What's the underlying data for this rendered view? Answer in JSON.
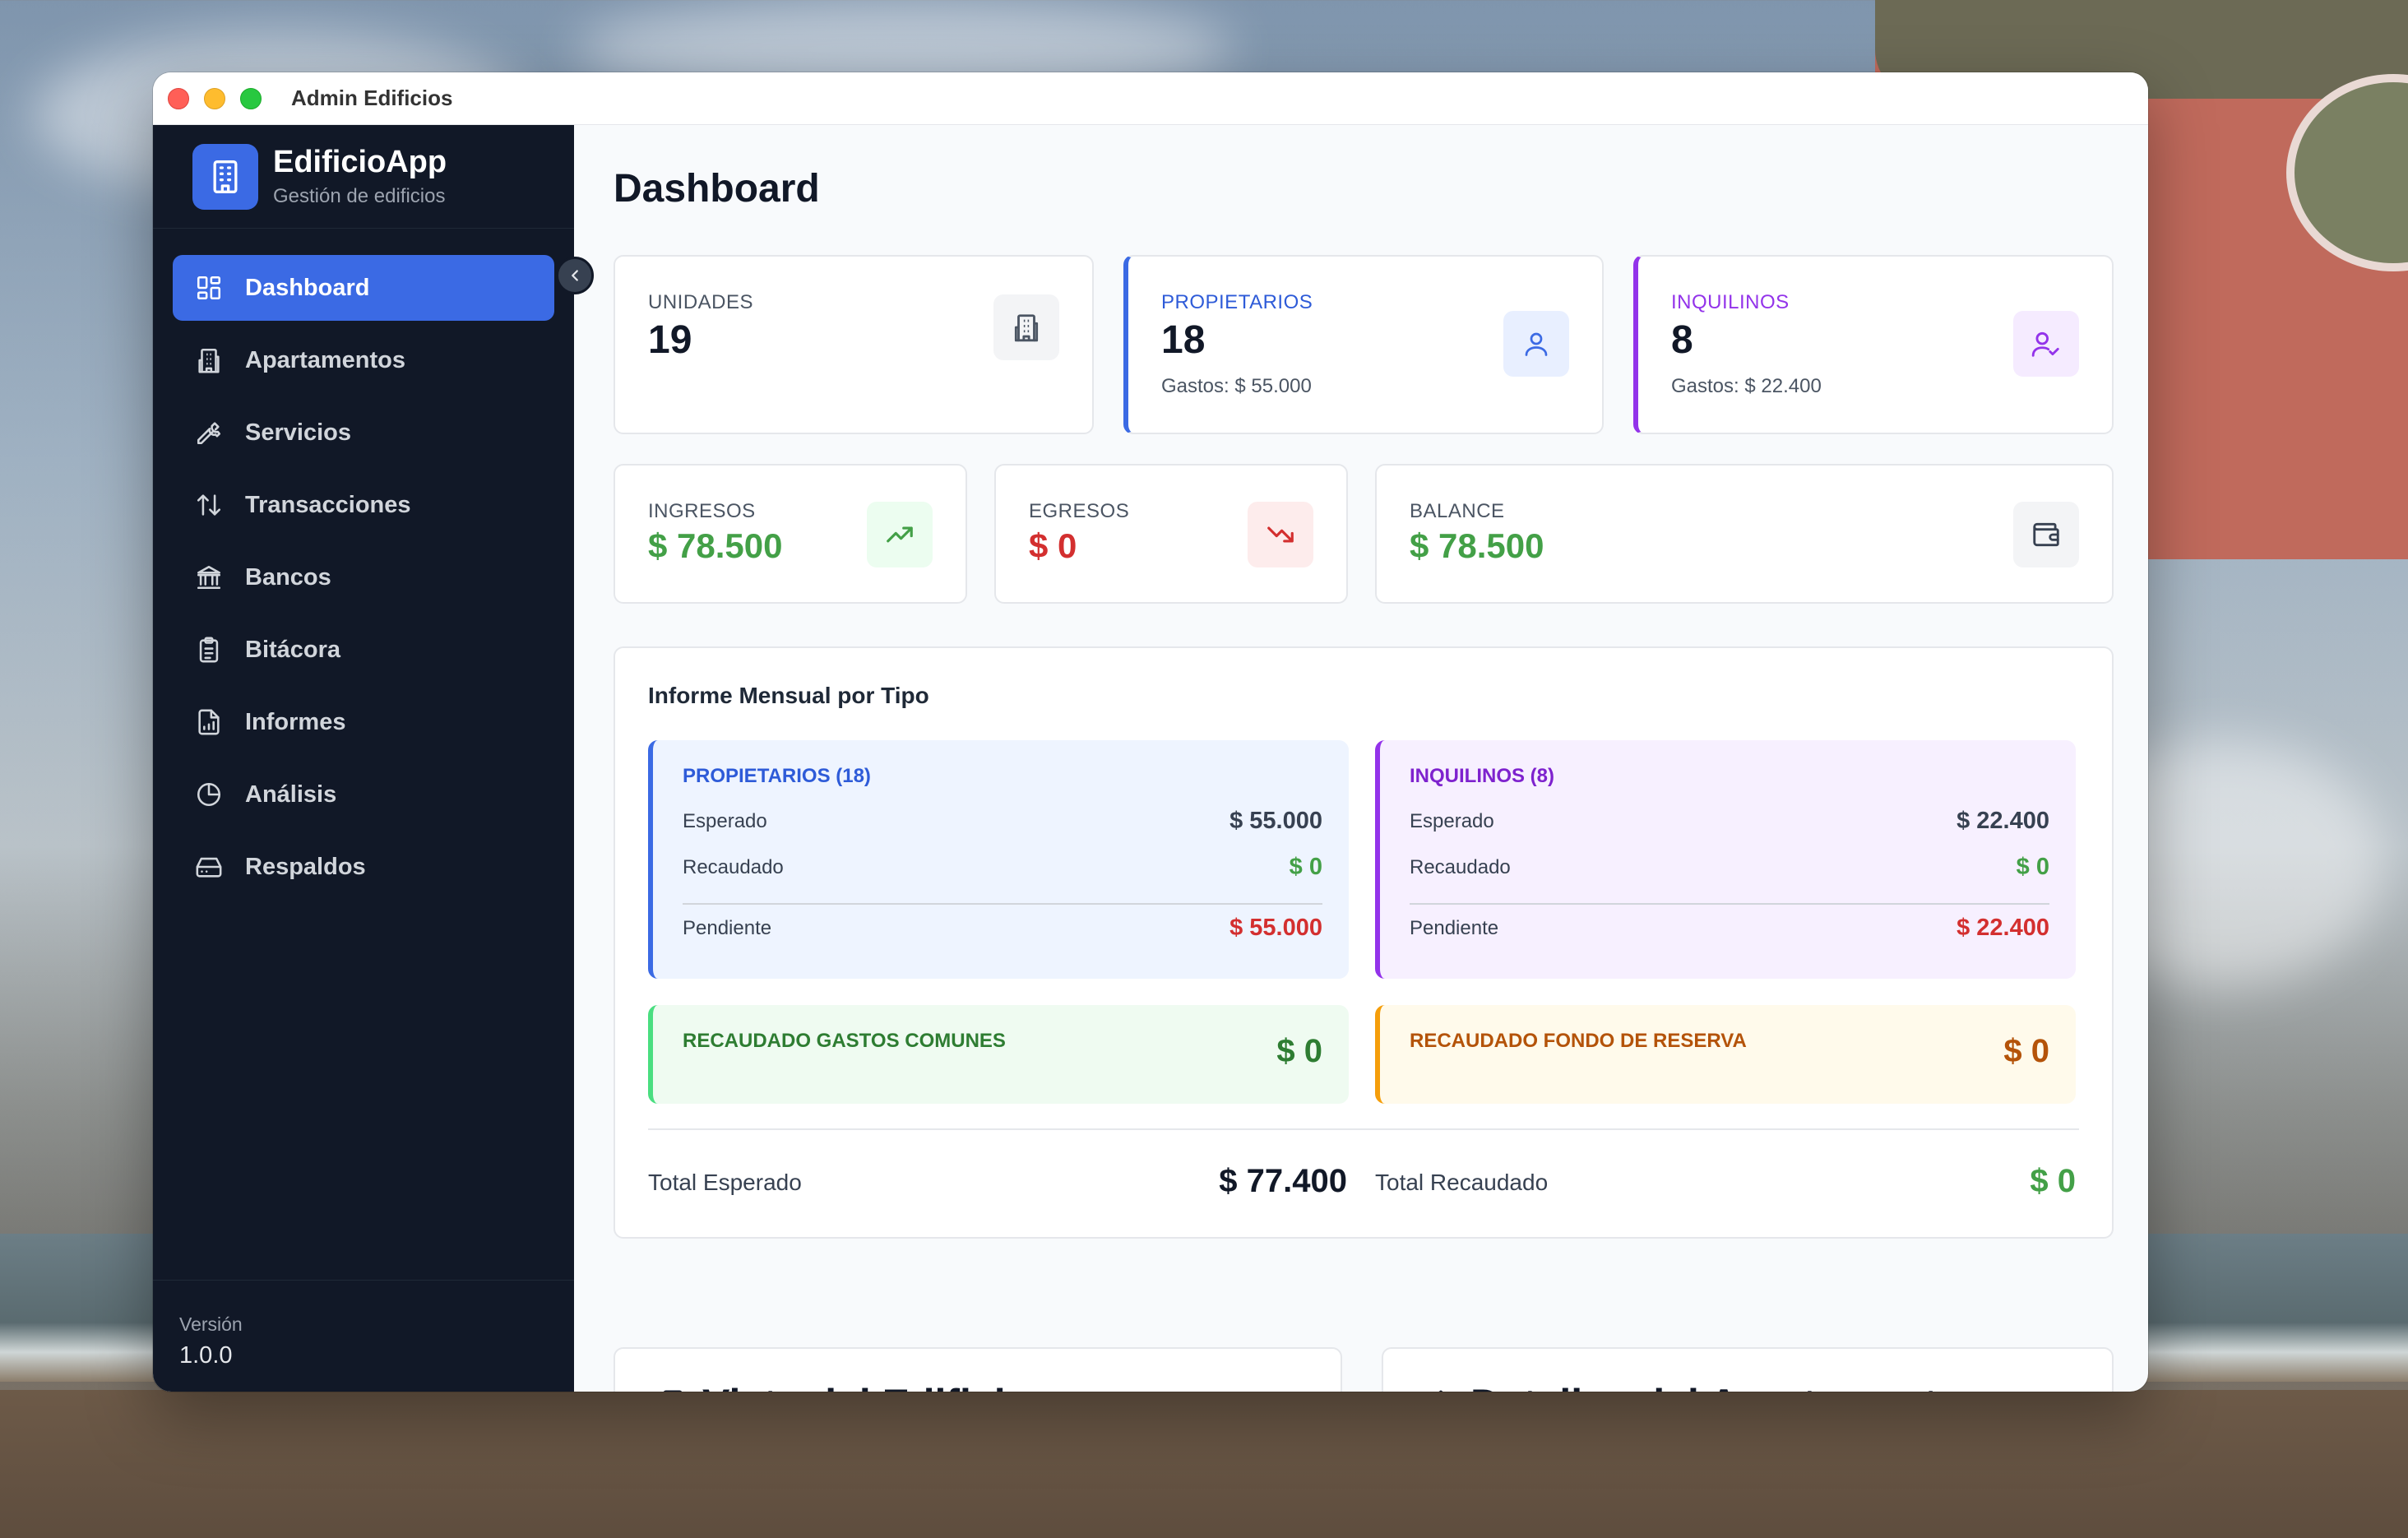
{
  "window": {
    "title": "Admin Edificios"
  },
  "brand": {
    "name": "EdificioApp",
    "subtitle": "Gestión de edificios"
  },
  "nav": {
    "items": [
      {
        "label": "Dashboard",
        "icon": "dashboard-icon",
        "active": true
      },
      {
        "label": "Apartamentos",
        "icon": "building-icon"
      },
      {
        "label": "Servicios",
        "icon": "wrench-icon"
      },
      {
        "label": "Transacciones",
        "icon": "arrows-up-down-icon"
      },
      {
        "label": "Bancos",
        "icon": "bank-icon"
      },
      {
        "label": "Bitácora",
        "icon": "clipboard-icon"
      },
      {
        "label": "Informes",
        "icon": "report-file-icon"
      },
      {
        "label": "Análisis",
        "icon": "pie-chart-icon"
      },
      {
        "label": "Respaldos",
        "icon": "hard-drive-icon"
      }
    ]
  },
  "footer": {
    "version_label": "Versión",
    "version_value": "1.0.0"
  },
  "page": {
    "title": "Dashboard"
  },
  "stats": {
    "unidades": {
      "label": "UNIDADES",
      "value": "19",
      "icon": "building-icon"
    },
    "propietarios": {
      "label": "PROPIETARIOS",
      "value": "18",
      "sub": "Gastos: $ 55.000",
      "icon": "user-icon"
    },
    "inquilinos": {
      "label": "INQUILINOS",
      "value": "8",
      "sub": "Gastos: $ 22.400",
      "icon": "user-check-icon"
    }
  },
  "money": {
    "ingresos": {
      "label": "INGRESOS",
      "value": "$ 78.500",
      "icon": "trending-up-icon"
    },
    "egresos": {
      "label": "EGRESOS",
      "value": "$ 0",
      "icon": "trending-down-icon"
    },
    "balance": {
      "label": "BALANCE",
      "value": "$ 78.500",
      "icon": "wallet-icon"
    }
  },
  "report": {
    "title": "Informe Mensual por Tipo",
    "propietarios": {
      "title": "PROPIETARIOS (18)",
      "esperado_label": "Esperado",
      "esperado": "$ 55.000",
      "recaudado_label": "Recaudado",
      "recaudado": "$ 0",
      "pendiente_label": "Pendiente",
      "pendiente": "$ 55.000"
    },
    "inquilinos": {
      "title": "INQUILINOS (8)",
      "esperado_label": "Esperado",
      "esperado": "$ 22.400",
      "recaudado_label": "Recaudado",
      "recaudado": "$ 0",
      "pendiente_label": "Pendiente",
      "pendiente": "$ 22.400"
    },
    "gastos_comunes": {
      "label": "RECAUDADO GASTOS COMUNES",
      "value": "$ 0"
    },
    "fondo_reserva": {
      "label": "RECAUDADO FONDO DE RESERVA",
      "value": "$ 0"
    },
    "total_esperado_label": "Total Esperado",
    "total_esperado": "$ 77.400",
    "total_recaudado_label": "Total Recaudado",
    "total_recaudado": "$ 0"
  },
  "bottom": {
    "vista": {
      "title": "Vista del Edificio",
      "icon": "building-icon"
    },
    "detalles": {
      "title": "Detalles del Apartamento",
      "icon": "home-icon"
    }
  },
  "colors": {
    "sidebar_bg": "#111827",
    "accent": "#3b6ae4",
    "positive": "#43a047",
    "negative": "#d32f2f",
    "purple": "#9333ea",
    "orange": "#c2410c"
  }
}
